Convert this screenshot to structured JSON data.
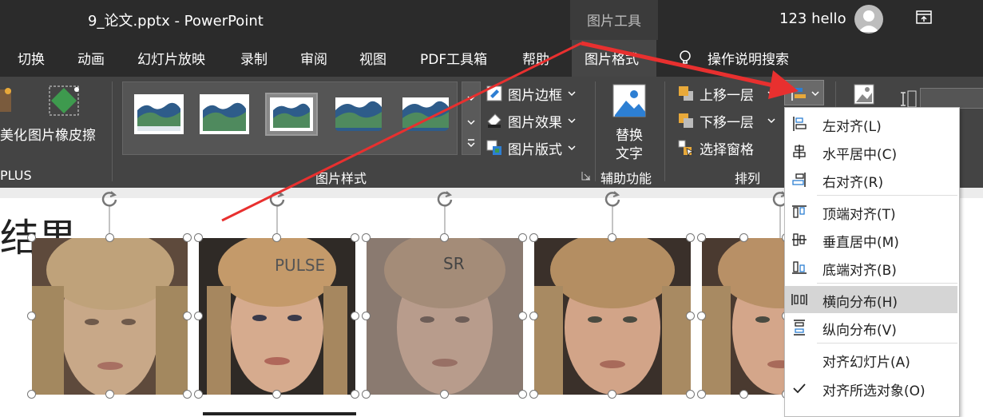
{
  "titlebar": {
    "document_title": "9_论文.pptx  -  PowerPoint",
    "context_group": "图片工具",
    "user_name": "123 hello"
  },
  "tabs": [
    "切换",
    "动画",
    "幻灯片放映",
    "录制",
    "审阅",
    "视图",
    "PDF工具箱",
    "帮助",
    "图片格式"
  ],
  "search": {
    "label": "操作说明搜索"
  },
  "ribbon": {
    "beautify_label": "美化",
    "eraser_label": "图片橡皮擦",
    "plus_group": "PLUS",
    "picture_border": "图片边框",
    "picture_effects": "图片效果",
    "picture_layout": "图片版式",
    "styles_group": "图片样式",
    "alt_text_line1": "替换",
    "alt_text_line2": "文字",
    "accessibility_group": "辅助功能",
    "bring_forward": "上移一层",
    "send_backward": "下移一层",
    "selection_pane": "选择窗格",
    "arrange_group": "排列"
  },
  "slide": {
    "title": "结果",
    "labels": [
      "PULSE",
      "SR"
    ]
  },
  "align_menu": {
    "items": [
      {
        "label": "左对齐(L)",
        "icon": "align-left-icon"
      },
      {
        "label": "水平居中(C)",
        "icon": "align-center-icon"
      },
      {
        "label": "右对齐(R)",
        "icon": "align-right-icon"
      },
      {
        "label": "顶端对齐(T)",
        "icon": "align-top-icon"
      },
      {
        "label": "垂直居中(M)",
        "icon": "align-middle-icon"
      },
      {
        "label": "底端对齐(B)",
        "icon": "align-bottom-icon"
      },
      {
        "label": "横向分布(H)",
        "icon": "distribute-horizontal-icon"
      },
      {
        "label": "纵向分布(V)",
        "icon": "distribute-vertical-icon"
      },
      {
        "label": "对齐幻灯片(A)",
        "icon": ""
      },
      {
        "label": "对齐所选对象(O)",
        "icon": "check-icon"
      }
    ],
    "highlighted": "横向分布(H)",
    "checked": "对齐所选对象(O)"
  },
  "colors": {
    "accent_arrow": "#e8302f",
    "icon_blue": "#2d7fd3",
    "dark_bg": "#2b2b2b",
    "ribbon_bg": "#444444"
  }
}
